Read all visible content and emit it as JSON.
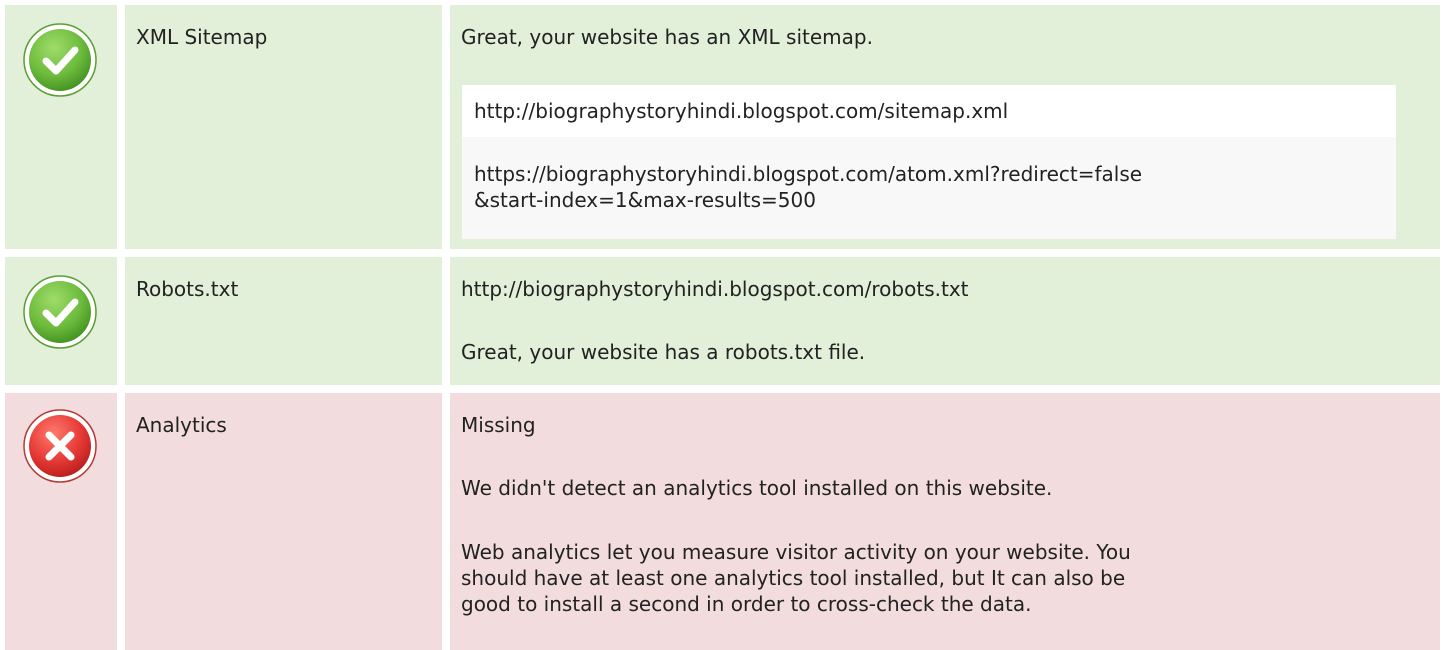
{
  "colors": {
    "pass_bg": "#e2efd9",
    "fail_bg": "#f2dcdd",
    "pass_icon": "#6dbb3c",
    "fail_icon": "#e53935"
  },
  "rows": [
    {
      "status": "pass",
      "status_icon": "check-circle-icon",
      "name": "XML Sitemap",
      "message": "Great, your website has an XML sitemap.",
      "urls": [
        "http://biographystoryhindi.blogspot.com/sitemap.xml",
        "https://biographystoryhindi.blogspot.com/atom.xml?redirect=false",
        "&start-index=1&max-results=500"
      ]
    },
    {
      "status": "pass",
      "status_icon": "check-circle-icon",
      "name": "Robots.txt",
      "url": "http://biographystoryhindi.blogspot.com/robots.txt",
      "message": "Great, your website has a robots.txt file."
    },
    {
      "status": "fail",
      "status_icon": "cross-circle-icon",
      "name": "Analytics",
      "result": "Missing",
      "message": "We didn't detect an analytics tool installed on this website.",
      "description": [
        "Web analytics let you measure visitor activity on your website. You",
        "should have at least one analytics tool installed, but It can also be",
        "good to install a second in order to cross-check the data."
      ]
    }
  ]
}
